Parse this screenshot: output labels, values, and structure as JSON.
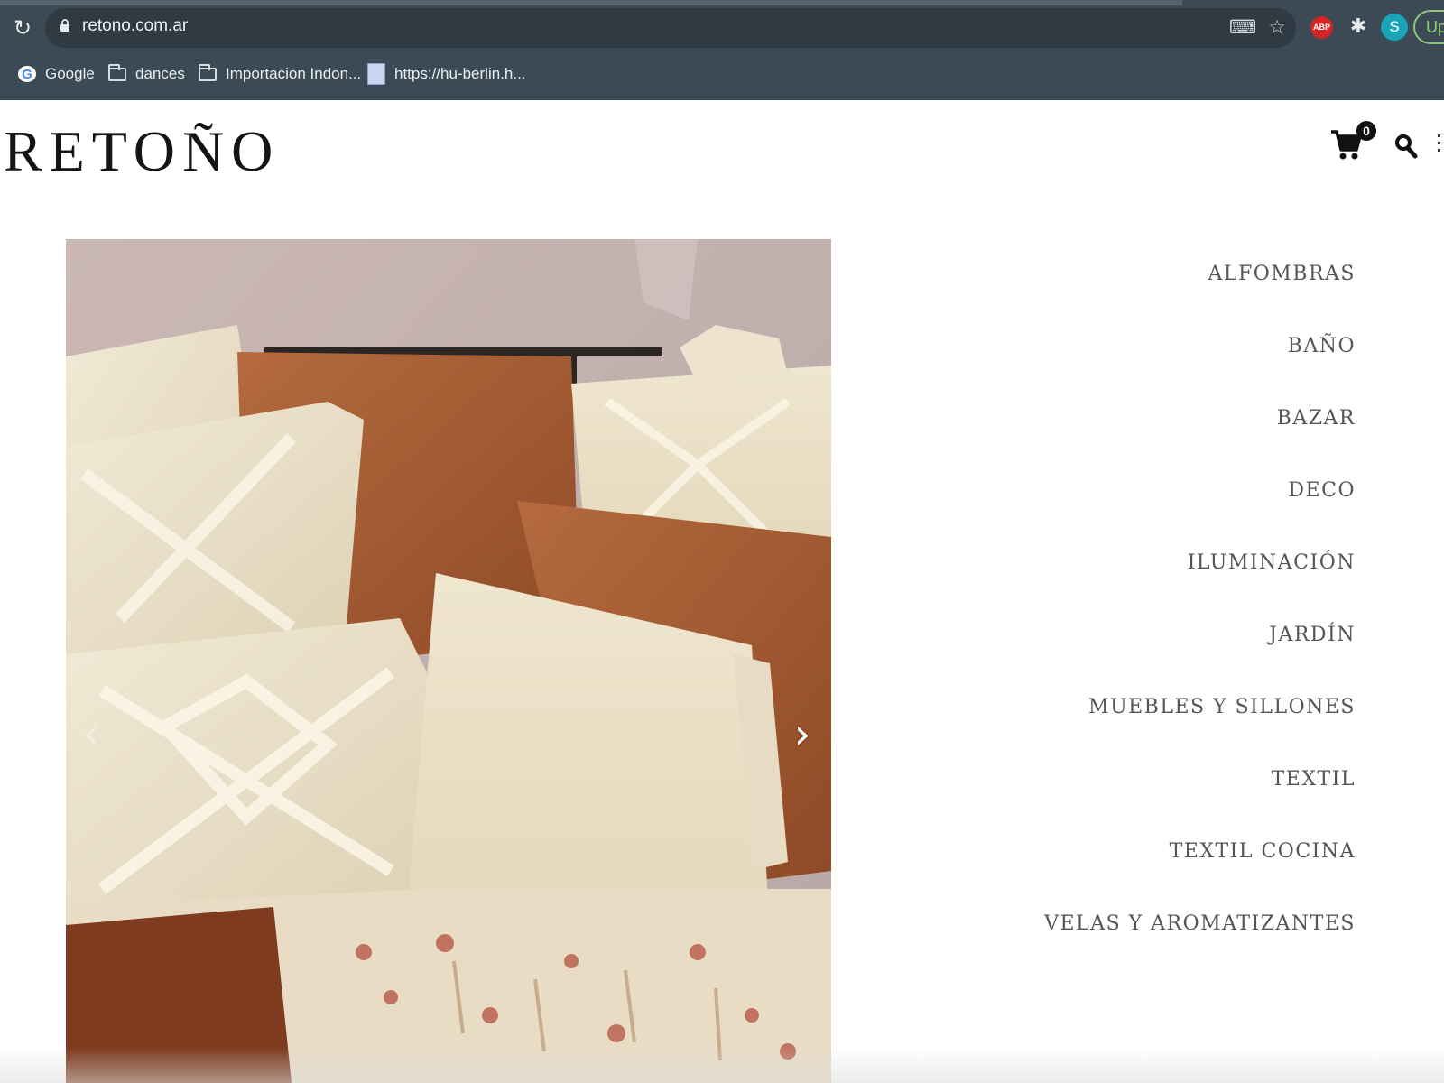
{
  "browser": {
    "url": "retono.com.ar",
    "bookmarks": [
      {
        "label": "Google",
        "icon": "google-icon"
      },
      {
        "label": "dances",
        "icon": "folder-icon"
      },
      {
        "label": "Importacion Indon...",
        "icon": "folder-icon"
      },
      {
        "label": "https://hu-berlin.h...",
        "icon": "favicon-icon"
      }
    ],
    "extensions": {
      "abp_label": "ABP",
      "profile_initial": "S",
      "update_label": "Up"
    }
  },
  "site": {
    "logo": "RETOÑO",
    "cart_count": "0"
  },
  "categories": [
    "ALFOMBRAS",
    "BAÑO",
    "BAZAR",
    "DECO",
    "ILUMINACIÓN",
    "JARDÍN",
    "MUEBLES Y SILLONES",
    "TEXTIL",
    "TEXTIL COCINA",
    "VELAS Y AROMATIZANTES"
  ],
  "colors": {
    "chrome": "#3c4a55",
    "omnibox": "#2f3a42",
    "menu_text": "#555555",
    "logo_text": "#141414"
  }
}
